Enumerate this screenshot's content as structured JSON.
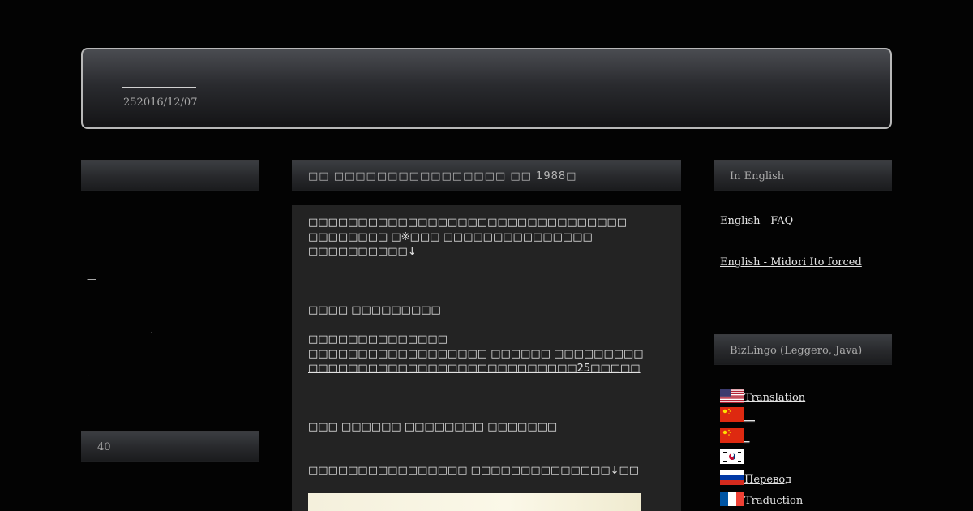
{
  "header": {
    "title": "",
    "date": "252016/12/07"
  },
  "left_sidebar": {
    "top_bar_title": "",
    "marks": [
      "—",
      ".",
      "."
    ],
    "count_bar": "40"
  },
  "main": {
    "post_title": "□□ □□□□□□□□□□□□□□□□ □□ 1988□",
    "lines": [
      "□□□□□□□□□□□□□□□□□□□□□□□□□□□□□□□□",
      "□□□□□□□□ □※□□□ □□□□□□□□□□□□□□□",
      "□□□□□□□□□□↓",
      "□□□□ □□□□□□□□□",
      "□□□□□□□□□□□□□□",
      "□□□□□□□□□□□□□□□□□□ □□□□□□ □□□□□□□□□",
      "□□□□□□□□□□□□□□□□□□□□□□□□□□□25□□□□□",
      "□□□ □□□□□□ □□□□□□□□ □□□□□□□",
      "□□□□□□□□□□□□□□□□ □□□□□□□□□□□□□□↓□□"
    ]
  },
  "right_sidebar": {
    "section1_title": "In English",
    "links": [
      "English - FAQ",
      "English - Midori Ito forced"
    ],
    "section2_title": "BizLingo (Leggero, Java)",
    "languages": [
      {
        "flag": "us-flag-icon",
        "label": "Translation"
      },
      {
        "flag": "cn-flag-icon",
        "label": "__"
      },
      {
        "flag": "cn-flag-icon",
        "label": "_"
      },
      {
        "flag": "kr-flag-icon",
        "label": ""
      },
      {
        "flag": "ru-flag-icon",
        "label": "Перевод"
      },
      {
        "flag": "fr-flag-icon",
        "label": "Traduction"
      }
    ]
  },
  "colors": {
    "background": "#030303",
    "panel": "#232323",
    "bar_top": "#3c3e42",
    "bar_bottom": "#1b1c1e",
    "border": "#b8b8b8"
  }
}
